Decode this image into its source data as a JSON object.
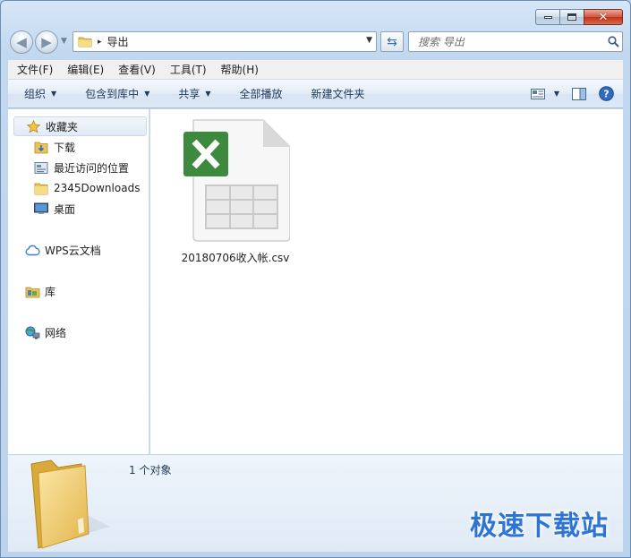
{
  "window": {
    "caption": {
      "minimize": "–",
      "maximize": "□",
      "close": "✕"
    }
  },
  "address": {
    "path": "导出",
    "separator": "▸"
  },
  "search": {
    "placeholder": "搜索 导出"
  },
  "menu": [
    {
      "label": "文件(F)"
    },
    {
      "label": "编辑(E)"
    },
    {
      "label": "查看(V)"
    },
    {
      "label": "工具(T)"
    },
    {
      "label": "帮助(H)"
    }
  ],
  "commands": [
    {
      "label": "组织",
      "dropdown": true
    },
    {
      "label": "包含到库中",
      "dropdown": true
    },
    {
      "label": "共享",
      "dropdown": true
    },
    {
      "label": "全部播放",
      "dropdown": false
    },
    {
      "label": "新建文件夹",
      "dropdown": false
    }
  ],
  "sidebar": {
    "favorites": {
      "label": "收藏夹",
      "items": [
        {
          "label": "下载",
          "icon": "download-folder-icon"
        },
        {
          "label": "最近访问的位置",
          "icon": "recent-places-icon"
        },
        {
          "label": "2345Downloads",
          "icon": "folder-icon"
        },
        {
          "label": "桌面",
          "icon": "desktop-icon"
        }
      ]
    },
    "wps": {
      "label": "WPS云文档"
    },
    "libraries": {
      "label": "库"
    },
    "network": {
      "label": "网络"
    }
  },
  "files": [
    {
      "name": "20180706收入帐.csv",
      "icon": "excel-csv-icon"
    }
  ],
  "details": {
    "count": "1 个对象"
  },
  "watermark": "极速下载站",
  "colors": {
    "accent": "#2c74d6",
    "excel": "#3d8a3f",
    "selection": "#e1ebf6"
  }
}
